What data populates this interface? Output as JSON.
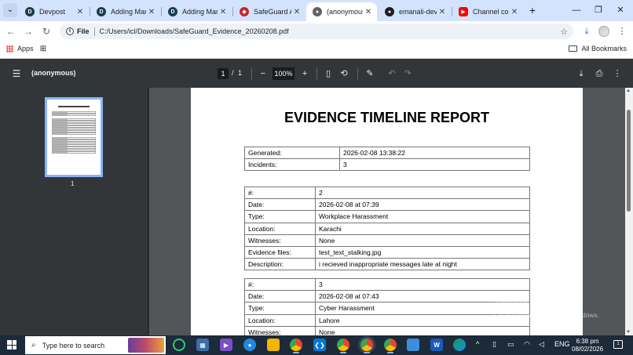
{
  "browser": {
    "tabs": [
      {
        "title": "Devpost",
        "favicon": "devpost-icon",
        "color": "#1a3d4e"
      },
      {
        "title": "Adding Markers",
        "favicon": "devpost-icon",
        "color": "#1a3d4e"
      },
      {
        "title": "Adding Markers",
        "favicon": "devpost-icon",
        "color": "#1a3d4e"
      },
      {
        "title": "SafeGuard AI",
        "favicon": "shield-icon",
        "color": "#c62828"
      },
      {
        "title": "(anonymous)",
        "favicon": "globe-icon",
        "color": "#5f6368"
      },
      {
        "title": "emanali-dev/SafeGuard",
        "favicon": "github-icon",
        "color": "#1f1f1f"
      },
      {
        "title": "Channel content",
        "favicon": "youtube-icon",
        "color": "#ff0000"
      }
    ],
    "address": {
      "chip": "File",
      "url": "C:/Users/icl/Downloads/SafeGuard_Evidence_20260208.pdf"
    },
    "bookmarks": {
      "apps_label": "Apps",
      "all_label": "All Bookmarks"
    }
  },
  "pdf_viewer": {
    "title": "(anonymous)",
    "page_current": "1",
    "page_total": "1",
    "zoom": "100%",
    "thumbnail_label": "1"
  },
  "document": {
    "title": "EVIDENCE TIMELINE REPORT",
    "meta": [
      {
        "label": "Generated:",
        "value": "2026-02-08 13:38:22"
      },
      {
        "label": "Incidents:",
        "value": "3"
      }
    ],
    "incidents": [
      {
        "rows": [
          {
            "label": "#:",
            "value": "2"
          },
          {
            "label": "Date:",
            "value": "2026-02-08 at 07:39"
          },
          {
            "label": "Type:",
            "value": "Workplace Harassment"
          },
          {
            "label": "Location:",
            "value": "Karachi"
          },
          {
            "label": "Witnesses:",
            "value": "None"
          },
          {
            "label": "Evidence files:",
            "value": "test_text_stalking.jpg"
          },
          {
            "label": "Description:",
            "value": "i recieved inappropriate messages late at night"
          }
        ]
      },
      {
        "rows": [
          {
            "label": "#:",
            "value": "3"
          },
          {
            "label": "Date:",
            "value": "2026-02-08 at 07:43"
          },
          {
            "label": "Type:",
            "value": "Cyber Harassment"
          },
          {
            "label": "Location:",
            "value": "Lahore"
          },
          {
            "label": "Witnesses:",
            "value": "None"
          }
        ]
      }
    ]
  },
  "watermark": {
    "line1": "Activate Windows",
    "line2": "Go to Settings to activate Windows."
  },
  "taskbar": {
    "search_placeholder": "Type here to search",
    "lang": "ENG",
    "time": "6:38 pm",
    "date": "08/02/2026",
    "notification_count": "1"
  }
}
